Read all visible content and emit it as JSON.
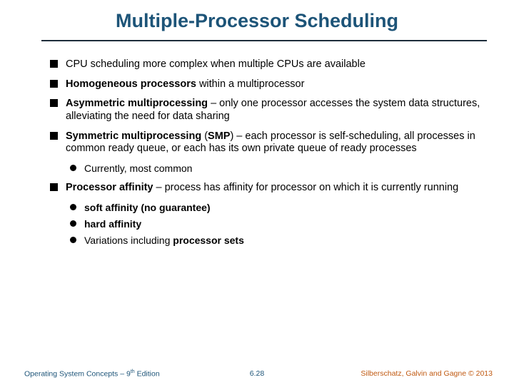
{
  "title": "Multiple-Processor Scheduling",
  "bullets": {
    "b1": "CPU scheduling more complex when multiple CPUs are available",
    "b2a": "Homogeneous processors",
    "b2b": " within a multiprocessor",
    "b3a": "Asymmetric multiprocessing",
    "b3b": " – only one processor accesses the system data structures, alleviating the need for data sharing",
    "b4a": "Symmetric multiprocessing",
    "b4b": " (",
    "b4c": "SMP",
    "b4d": ") – each processor is self-scheduling, all processes in common ready queue, or each has its own private queue of ready processes",
    "b4s1": "Currently, most common",
    "b5a": "Processor affinity",
    "b5b": " – process has affinity for processor on which it is currently running",
    "b5s1": "soft affinity (no guarantee)",
    "b5s2": "hard affinity",
    "b5s3a": "Variations including ",
    "b5s3b": "processor sets"
  },
  "footer": {
    "left_a": "Operating System Concepts – 9",
    "left_sup": "th",
    "left_b": " Edition",
    "center": "6.28",
    "right": "Silberschatz, Galvin and Gagne © 2013"
  }
}
